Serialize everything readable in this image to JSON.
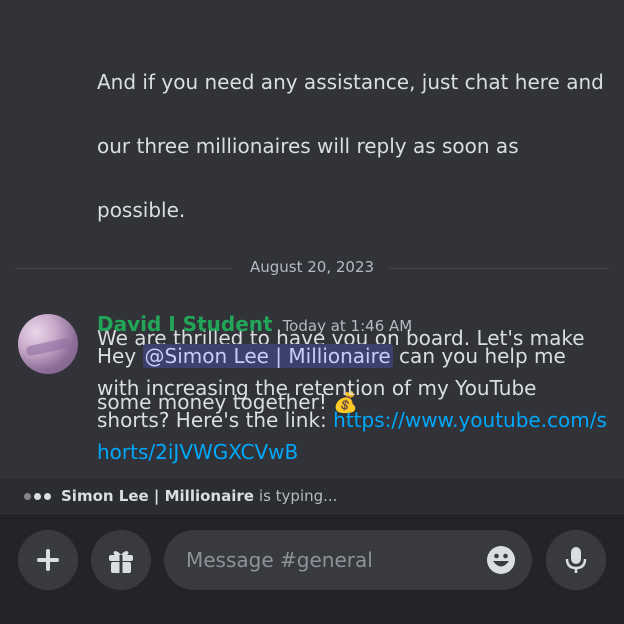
{
  "messages": [
    {
      "text_lines": [
        "And if you need any assistance, just chat here and",
        "our three millionaires will reply as soon as",
        "possible.",
        "",
        "We are thrilled to have you on board. Let's make",
        "some money together! 💰"
      ]
    }
  ],
  "divider": {
    "date": "August 20, 2023"
  },
  "message2": {
    "author": "David I Student",
    "author_color": "#23a559",
    "timestamp": "Today at 1:46 AM",
    "prefix": "Hey ",
    "mention": "@Simon Lee | Millionaire",
    "body": " can you help me with increasing the retention of my YouTube shorts? Here's the link: ",
    "link": "https://www.youtube.com/shorts/2iJVWGXCVwB"
  },
  "typing": {
    "name": "Simon Lee | Millionaire",
    "suffix": "is typing..."
  },
  "composer": {
    "placeholder": "Message #general"
  },
  "icons": [
    "plus-icon",
    "gift-icon",
    "emoji-icon",
    "microphone-icon"
  ],
  "colors": {
    "background": "#313338",
    "link": "#00a8fc",
    "mention_bg": "#3c4270"
  }
}
